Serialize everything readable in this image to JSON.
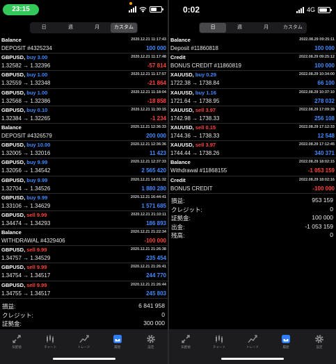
{
  "left": {
    "status": {
      "time": "23:15"
    },
    "segments": [
      {
        "label": "日",
        "active": false
      },
      {
        "label": "週",
        "active": false
      },
      {
        "label": "月",
        "active": false
      },
      {
        "label": "カスタム",
        "active": true
      }
    ],
    "rows": [
      {
        "title": "Balance",
        "side": "",
        "datetime": "2020.12.21 11:17:43",
        "detail": "DEPOSIT #4325234",
        "value": "100 000",
        "vtype": "pos"
      },
      {
        "title": "GBPUSD,",
        "side": "buy 3.00",
        "stype": "buy",
        "datetime": "2020.12.21 11:17:48",
        "detail": "1.32582 → 1.32396",
        "value": "-57 814",
        "vtype": "neg"
      },
      {
        "title": "GBPUSD,",
        "side": "buy 1.00",
        "stype": "buy",
        "datetime": "2020.12.21 11:17:57",
        "detail": "1.32559 → 1.32348",
        "value": "-21 864",
        "vtype": "neg"
      },
      {
        "title": "GBPUSD,",
        "side": "buy 1.00",
        "stype": "buy",
        "datetime": "2020.12.21 11:18:04",
        "detail": "1.32568 → 1.32386",
        "value": "-18 858",
        "vtype": "neg"
      },
      {
        "title": "GBPUSD,",
        "side": "buy 0.10",
        "stype": "buy",
        "datetime": "2020.12.21 11:30:15",
        "detail": "1.32384 → 1.32265",
        "value": "-1 234",
        "vtype": "neg"
      },
      {
        "title": "Balance",
        "side": "",
        "datetime": "2020.12.21 12:36:33",
        "detail": "DEPOSIT #4326579",
        "value": "200 000",
        "vtype": "pos"
      },
      {
        "title": "GBPUSD,",
        "side": "buy 10.00",
        "stype": "buy",
        "datetime": "2020.12.21 12:36:36",
        "detail": "1.32005 → 1.32016",
        "value": "11 423",
        "vtype": "pos"
      },
      {
        "title": "GBPUSD,",
        "side": "buy 9.99",
        "stype": "buy",
        "datetime": "2020.12.21 12:37:33",
        "detail": "1.32056 → 1.34542",
        "value": "2 565 420",
        "vtype": "pos"
      },
      {
        "title": "GBPUSD,",
        "side": "buy 9.99",
        "stype": "buy",
        "datetime": "2020.12.21 14:01:32",
        "detail": "1.32704 → 1.34526",
        "value": "1 880 280",
        "vtype": "pos"
      },
      {
        "title": "GBPUSD,",
        "side": "buy 9.99",
        "stype": "buy",
        "datetime": "2020.12.21 16:44:41",
        "detail": "1.33106 → 1.34629",
        "value": "1 571 685",
        "vtype": "pos"
      },
      {
        "title": "GBPUSD,",
        "side": "sell 9.99",
        "stype": "sell",
        "datetime": "2020.12.21 21:10:11",
        "detail": "1.34474 → 1.34293",
        "value": "186 893",
        "vtype": "pos"
      },
      {
        "title": "Balance",
        "side": "",
        "datetime": "2020.12.21 21:22:34",
        "detail": "WITHDRAWAL #4329406",
        "value": "-100 000",
        "vtype": "neg"
      },
      {
        "title": "GBPUSD,",
        "side": "sell 9.99",
        "stype": "sell",
        "datetime": "2020.12.21 21:26:38",
        "detail": "1.34757 → 1.34529",
        "value": "235 454",
        "vtype": "pos"
      },
      {
        "title": "GBPUSD,",
        "side": "sell 9.99",
        "stype": "sell",
        "datetime": "2020.12.21 21:26:41",
        "detail": "1.34754 → 1.34517",
        "value": "244 770",
        "vtype": "pos"
      },
      {
        "title": "GBPUSD,",
        "side": "sell 9.99",
        "stype": "sell",
        "datetime": "2020.12.21 21:26:44",
        "detail": "1.34755 → 1.34517",
        "value": "245 803",
        "vtype": "pos"
      }
    ],
    "summary": [
      {
        "label": "損益:",
        "value": "6 841 958"
      },
      {
        "label": "クレジット:",
        "value": "0"
      },
      {
        "label": "証拠金:",
        "value": "300 000"
      }
    ],
    "tabs": [
      {
        "label": "気配値",
        "icon": "quotes-icon"
      },
      {
        "label": "チャート",
        "icon": "chart-icon"
      },
      {
        "label": "トレード",
        "icon": "trade-icon"
      },
      {
        "label": "履歴",
        "icon": "history-icon",
        "active": true
      },
      {
        "label": "設定",
        "icon": "settings-icon"
      }
    ]
  },
  "right": {
    "status": {
      "time": "0:02",
      "network": "4G"
    },
    "segments": [
      {
        "label": "日",
        "active": true
      },
      {
        "label": "週",
        "active": false
      },
      {
        "label": "月",
        "active": false
      },
      {
        "label": "カスタム",
        "active": false
      }
    ],
    "rows": [
      {
        "title": "Balance",
        "side": "",
        "datetime": "2022.08.29 09:25:11",
        "detail": "Deposit #11860818",
        "value": "100 000",
        "vtype": "pos"
      },
      {
        "title": "Credit",
        "side": "",
        "datetime": "2022.08.29 09:25:12",
        "detail": "BONUS CREDIT #11860819",
        "value": "100 000",
        "vtype": "pos"
      },
      {
        "title": "XAUUSD,",
        "side": "buy 0.29",
        "stype": "buy",
        "datetime": "2022.08.29 10:34:00",
        "detail": "1722.38 → 1738.84",
        "value": "66 100",
        "vtype": "pos"
      },
      {
        "title": "XAUUSD,",
        "side": "buy 1.16",
        "stype": "buy",
        "datetime": "2022.08.29 10:37:10",
        "detail": "1721.64 → 1738.95",
        "value": "278 032",
        "vtype": "pos"
      },
      {
        "title": "XAUUSD,",
        "side": "sell 3.97",
        "stype": "sell",
        "datetime": "2022.08.29 17:09:39",
        "detail": "1742.98 → 1738.33",
        "value": "256 108",
        "vtype": "pos"
      },
      {
        "title": "XAUUSD,",
        "side": "sell 0.15",
        "stype": "sell",
        "datetime": "2022.08.29 17:12:33",
        "detail": "1744.36 → 1738.33",
        "value": "12 548",
        "vtype": "pos"
      },
      {
        "title": "XAUUSD,",
        "side": "sell 3.97",
        "stype": "sell",
        "datetime": "2022.08.29 17:12:45",
        "detail": "1744.44 → 1738.26",
        "value": "340 371",
        "vtype": "pos"
      },
      {
        "title": "Balance",
        "side": "",
        "datetime": "2022.08.29 18:02:15",
        "detail": "Withdrawal #11868155",
        "value": "-1 053 159",
        "vtype": "neg"
      },
      {
        "title": "Credit",
        "side": "",
        "datetime": "2022.08.29 18:02:16",
        "detail": "BONUS CREDIT",
        "value": "-100 000",
        "vtype": "neg"
      }
    ],
    "summary": [
      {
        "label": "損益:",
        "value": "953 159"
      },
      {
        "label": "クレジット:",
        "value": "0"
      },
      {
        "label": "証拠金:",
        "value": "100 000"
      },
      {
        "label": "出金:",
        "value": "-1 053 159"
      },
      {
        "label": "残高:",
        "value": "0"
      }
    ],
    "tabs": [
      {
        "label": "気配値",
        "icon": "quotes-icon"
      },
      {
        "label": "チャート",
        "icon": "chart-icon"
      },
      {
        "label": "トレード",
        "icon": "trade-icon"
      },
      {
        "label": "履歴",
        "icon": "history-icon",
        "active": true
      },
      {
        "label": "設定",
        "icon": "settings-icon"
      }
    ]
  },
  "colors": {
    "buy": "#3f8cff",
    "sell": "#ff453a",
    "positive": "#3f8cff",
    "negative": "#ff453a",
    "status_pill": "#34c759",
    "active_tab": "#2f7cf6"
  }
}
